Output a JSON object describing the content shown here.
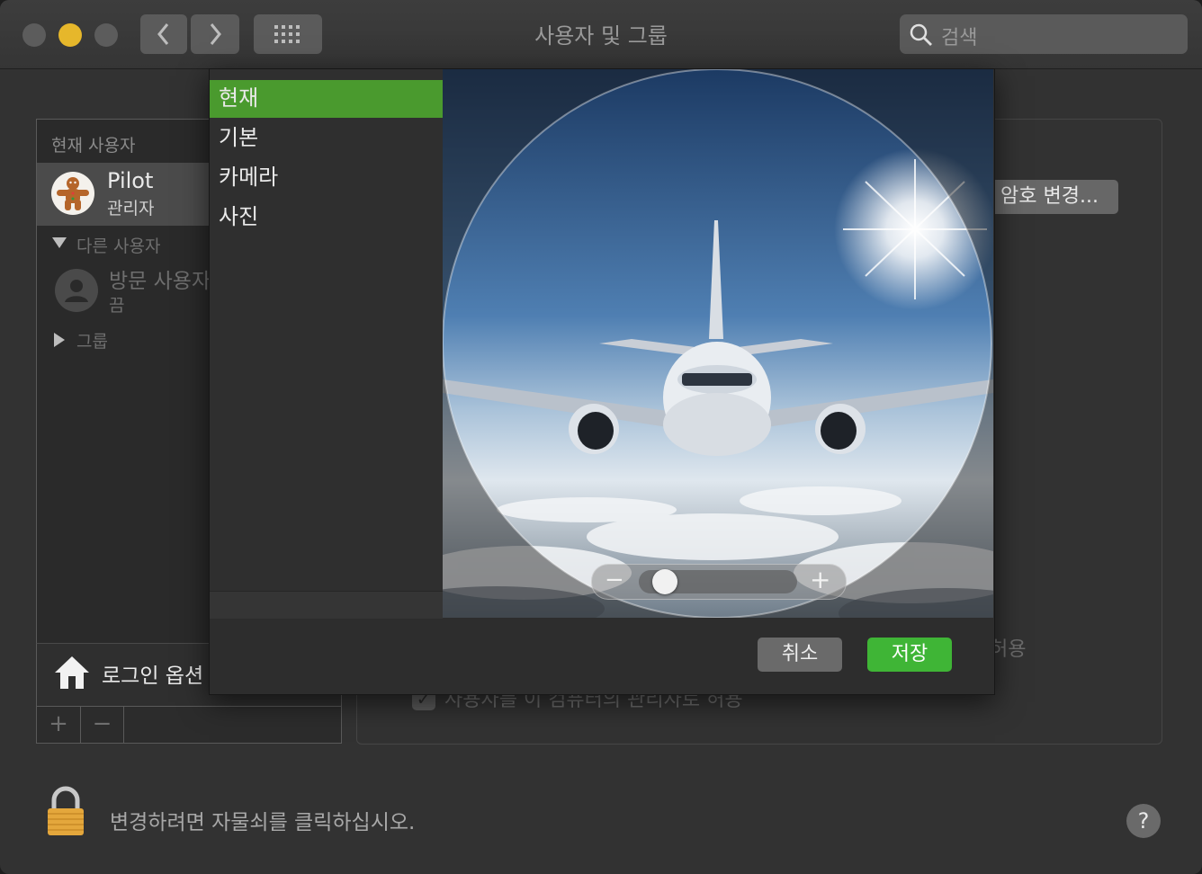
{
  "window": {
    "title": "사용자 및 그룹",
    "search_placeholder": "검색",
    "back_symbol": "‹",
    "forward_symbol": "›"
  },
  "sidebar": {
    "current_users_header": "현재 사용자",
    "current_user": {
      "name": "Pilot",
      "role": "관리자"
    },
    "other_users_header": "다른 사용자",
    "guest_user": {
      "name": "방문 사용자",
      "status": "끔"
    },
    "groups_label": "그룹",
    "login_options_label": "로그인 옵션",
    "add_symbol": "+",
    "remove_symbol": "−"
  },
  "right_panel": {
    "change_password_label": "암호 변경...",
    "allow_text": "허용",
    "admin_checkbox_label": "사용자를 이 컴퓨터의 관리자로 허용",
    "admin_checkbox_checked": true
  },
  "picture_sheet": {
    "sources": [
      "현재",
      "기본",
      "카메라",
      "사진"
    ],
    "selected_source": "현재",
    "zoom_minus": "−",
    "zoom_plus": "+",
    "zoom_level": 0.1,
    "cancel_label": "취소",
    "save_label": "저장"
  },
  "footer": {
    "lock_text": "변경하려면 자물쇠를 클릭하십시오.",
    "help_symbol": "?"
  },
  "colors": {
    "selection_green": "#4a9a2e",
    "save_green": "#3fb536",
    "close_light": "#5c5c5c",
    "minimize_light": "#e6b72b",
    "zoom_light": "#5c5c5c"
  }
}
